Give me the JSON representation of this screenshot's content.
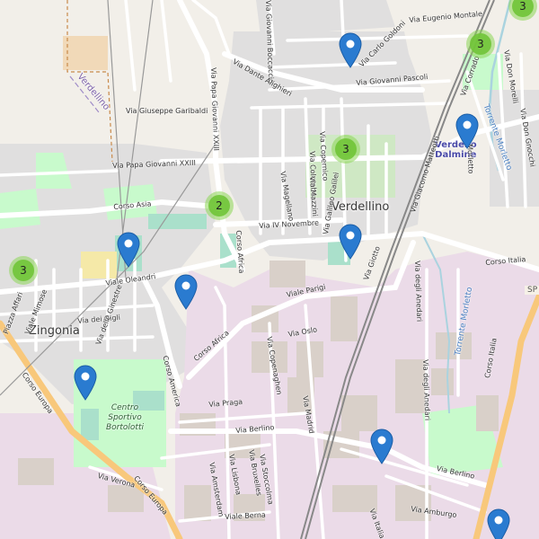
{
  "map": {
    "colors": {
      "land": "#f2efe9",
      "residential": "#e0dfdf",
      "industrial": "#ebdbe8",
      "park": "#c8facc",
      "pitch": "#aae0cb",
      "road": "#ffffff",
      "primary": "#f8c87b",
      "water": "#aad3df",
      "marker": "#2a7bd0",
      "cluster": "#8cd655"
    },
    "places": [
      {
        "id": "verdellino",
        "text": "Verdellino"
      },
      {
        "id": "zingonia",
        "text": "Zingonia"
      }
    ],
    "hamlet": {
      "text": "Verdellino"
    },
    "station": {
      "line1": "Verdello",
      "line2": "Dalmine"
    },
    "poi": {
      "line1": "Centro",
      "line2": "Sportivo",
      "line3": "Bortolotti"
    },
    "river_labels": [
      "Torrente Morletto",
      "Torrente Morletto"
    ],
    "street_labels": [
      "Via Eugenio Montale",
      "Via Carlo Goldoni",
      "Via Giovanni Pascoli",
      "Via Giovanni Boccaccio",
      "Via Dante Alighieri",
      "Via Papa Giovanni XXIII",
      "Via Giuseppe Garibaldi",
      "Via Papa Giovanni XXIII",
      "Corso Asia",
      "Via IV Novembre",
      "Via Magellano",
      "Via Colombo",
      "Via Copernico",
      "Via Mazzini",
      "Via Galileo Galilei",
      "Via Giotto",
      "Via Giacomo Matteotti",
      "Via Corrado",
      "Via Don Morelli",
      "Via Don Gnocchi",
      "Via Morletto",
      "Corso Italia",
      "Via degli Anedari",
      "Viale Oleandri",
      "Viale Parigi",
      "Via Oslo",
      "Corso Africa",
      "Corso Africa",
      "Via dei Gigli",
      "Via delle Ginestre",
      "Viale Mimose",
      "Piazza Affari",
      "Corso Europa",
      "Corso Europa",
      "Corso America",
      "Via Copenaghen",
      "Via Madrid",
      "Via Praga",
      "Via Berlino",
      "Via Berlino",
      "Via Amsterdam",
      "Via Lisbona",
      "Via Bruxelles",
      "Via Stoccolma",
      "Via Verona",
      "Viale Berna",
      "Via Amburgo",
      "Corso Italia",
      "Via degli Anedari",
      "Via Italia"
    ],
    "clusters": [
      {
        "count": "3"
      },
      {
        "count": "3"
      },
      {
        "count": "2"
      },
      {
        "count": "3"
      },
      {
        "count": "3"
      }
    ],
    "markers": 8,
    "edge_label": "SP"
  }
}
